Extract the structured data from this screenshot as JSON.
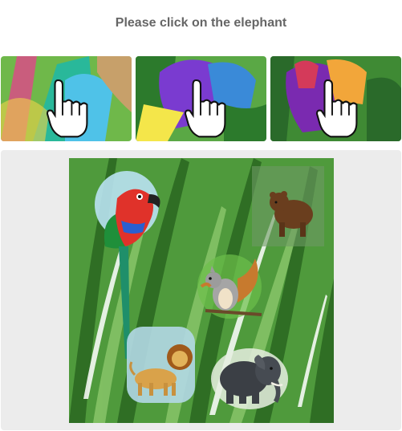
{
  "prompt": {
    "text": "Please click on the elephant"
  },
  "tiles": [
    {
      "name": "example-tile-1",
      "icon": "pointer-hand-icon",
      "colors": [
        "#29b89a",
        "#e0468a",
        "#4fc2e8",
        "#c7a06a"
      ]
    },
    {
      "name": "example-tile-2",
      "icon": "pointer-hand-icon",
      "colors": [
        "#7a3bd0",
        "#f4e64a",
        "#3a8ad8",
        "#2c7a2c"
      ]
    },
    {
      "name": "example-tile-3",
      "icon": "pointer-hand-icon",
      "colors": [
        "#d43a5a",
        "#f2a63a",
        "#7a2ab0",
        "#2a6a2a"
      ]
    }
  ],
  "scene": {
    "animals": [
      {
        "name": "parrot",
        "icon": "parrot-icon"
      },
      {
        "name": "bear",
        "icon": "bear-icon"
      },
      {
        "name": "squirrel",
        "icon": "squirrel-icon"
      },
      {
        "name": "lion",
        "icon": "lion-icon"
      },
      {
        "name": "elephant",
        "icon": "elephant-icon"
      }
    ],
    "colors": {
      "jungle": "#4f9a3c",
      "leaf_dark": "#2f6e24",
      "leaf_light": "#8cc86c",
      "panel": "#ececec"
    }
  }
}
